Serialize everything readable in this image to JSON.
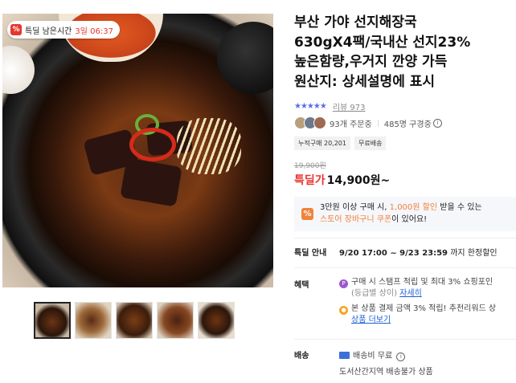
{
  "deal_badge": {
    "icon": "percent-icon",
    "label": "특딜 남은시간",
    "timer": "3일 06:37"
  },
  "product": {
    "title": "부산 가야 선지해장국\n630gX4팩/국내산 선지23%\n높은함량,우거지 깐양 가득\n원산지: 상세설명에 표시"
  },
  "rating": {
    "stars": "★★★★★",
    "review_label": "리뷰",
    "review_count": "973",
    "star_color": "#5c6ee6"
  },
  "stats": {
    "orders": "93개 주문중",
    "viewers": "485명 구경중"
  },
  "tags": [
    "누적구매 20,201",
    "무료배송"
  ],
  "price": {
    "original": "19,900원",
    "label": "특딜가",
    "value": "14,900원~",
    "accent": "#e8352f"
  },
  "coupon": {
    "line1_pre": "3만원 이상 구매 시, ",
    "line1_hl": "1,000원 할인",
    "line1_post": " 받을 수 있는",
    "line2_hl": "스토어 장바구니 쿠폰",
    "line2_post": "이 있어요!",
    "accent": "#f08339"
  },
  "deal_info": {
    "label": "특딜 안내",
    "period": "9/20 17:00 ~ 9/23 23:59",
    "suffix": " 까지 한정할인"
  },
  "benefits": {
    "label": "혜택",
    "item1": "구매 시 스탬프 적립 및 최대 3% 쇼핑포인",
    "item1_sub": "(등급별 상이)",
    "item1_link": "자세히",
    "item2": "본 상품 결제 금액 3% 적립! 추천리워드 상",
    "item2_link": "상품 더보기"
  },
  "shipping": {
    "label": "배송",
    "fee": "배송비 무료",
    "note": "도서산간지역 배송불가 상품"
  }
}
